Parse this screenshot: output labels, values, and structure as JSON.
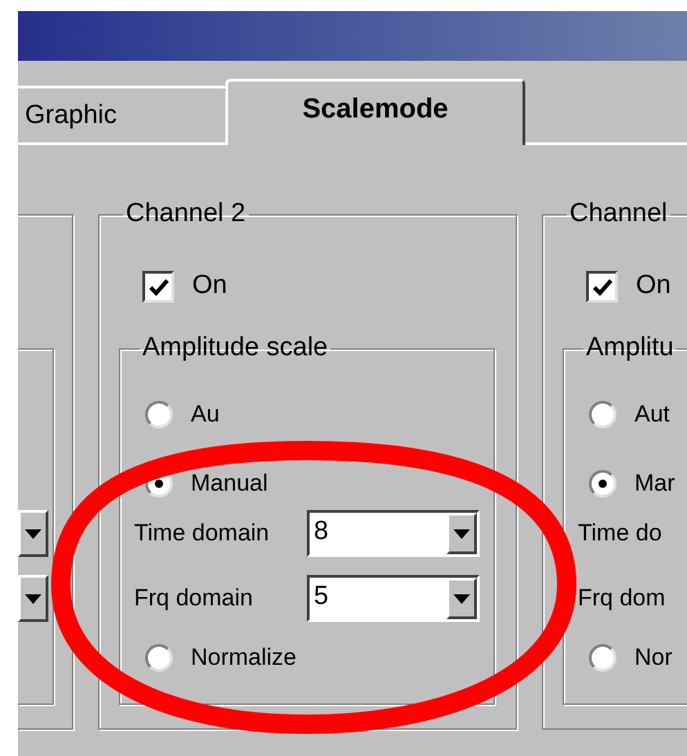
{
  "tabs": [
    {
      "label": "Graphic",
      "selected": false
    },
    {
      "label": "Scalemode",
      "selected": true
    }
  ],
  "channels": [
    {
      "kind": "cut_left"
    },
    {
      "kind": "group",
      "title": "Channel 2",
      "on": {
        "label": "On",
        "checked": true
      },
      "amplitude": {
        "title": "Amplitude scale",
        "options": [
          {
            "label": "Au",
            "selected": false
          },
          {
            "label": "Manual",
            "selected": true
          },
          {
            "label": "Normalize",
            "selected": false
          }
        ],
        "time_domain": {
          "label": "Time domain",
          "value": "8"
        },
        "frq_domain": {
          "label": "Frq domain",
          "value": "5"
        }
      }
    },
    {
      "kind": "group",
      "title": "Channel",
      "on": {
        "label": "On",
        "checked": true
      },
      "amplitude": {
        "title": "Amplitu",
        "options": [
          {
            "label": "Aut",
            "selected": false
          },
          {
            "label": "Mar",
            "selected": true
          },
          {
            "label": "Nor",
            "selected": false
          }
        ],
        "time_domain": {
          "label": "Time do"
        },
        "frq_domain": {
          "label": "Frq dom"
        }
      }
    }
  ],
  "annotation": {
    "kind": "ellipse"
  }
}
